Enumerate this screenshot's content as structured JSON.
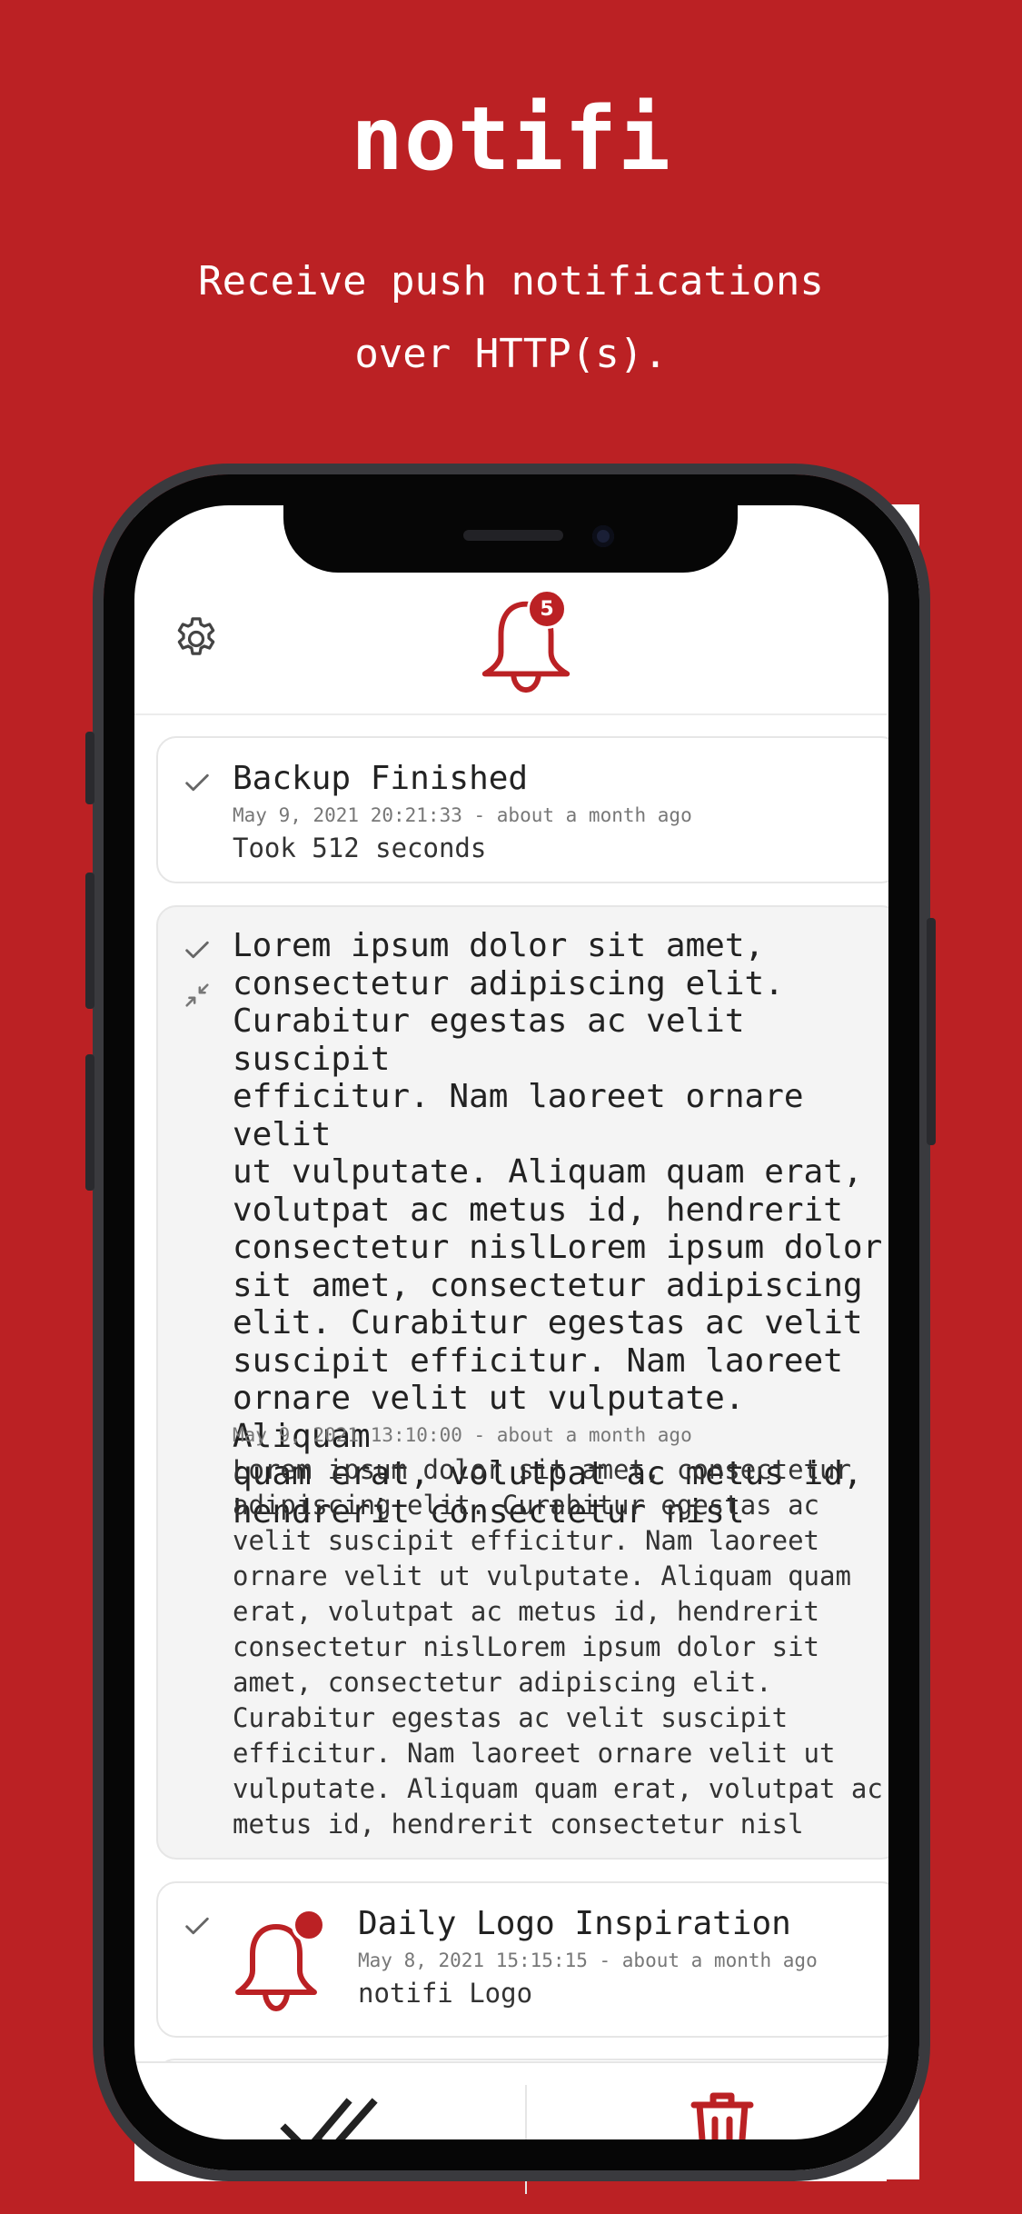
{
  "hero": {
    "title": "notifi",
    "subtitle_line1": "Receive push notifications",
    "subtitle_line2": "over HTTP(s)."
  },
  "header": {
    "settings_icon": "gear-icon",
    "bell_icon": "bell-icon",
    "badge_count": "5"
  },
  "notifications": [
    {
      "title": "Backup Finished",
      "time": "May 9, 2021 20:21:33 - about a month ago",
      "message": "Took 512 seconds"
    },
    {
      "title_lines": [
        "Lorem ipsum dolor sit amet,",
        "consectetur adipiscing elit.",
        "Curabitur egestas ac velit suscipit",
        "efficitur. Nam laoreet ornare velit",
        "ut vulputate. Aliquam quam erat,",
        "volutpat ac metus id, hendrerit",
        "consectetur nislLorem ipsum dolor",
        "sit amet, consectetur adipiscing",
        "elit. Curabitur egestas ac velit",
        "suscipit efficitur. Nam laoreet",
        "ornare velit ut vulputate. Aliquam",
        "quam erat, volutpat ac metus id,",
        "hendrerit consectetur nisl"
      ],
      "time": "May 9, 2021 13:10:00 - about a month ago",
      "message_lines": [
        "Lorem ipsum dolor sit amet, consectetur",
        "adipiscing elit. Curabitur egestas ac",
        "velit suscipit efficitur. Nam laoreet",
        "ornare velit ut vulputate. Aliquam quam",
        "erat, volutpat ac metus id, hendrerit",
        "consectetur nislLorem ipsum dolor sit",
        "amet, consectetur adipiscing elit.",
        "Curabitur egestas ac velit suscipit",
        "efficitur. Nam laoreet ornare velit ut",
        "vulputate. Aliquam quam erat, volutpat ac",
        "metus id, hendrerit consectetur nisl"
      ]
    },
    {
      "title": "Daily Logo Inspiration",
      "time": "May 8, 2021 15:15:15 - about a month ago",
      "message": "notifi Logo"
    }
  ],
  "bottom_bar": {
    "mark_all_icon": "double-check-icon",
    "delete_icon": "trash-icon"
  },
  "colors": {
    "brand": "#bb2124",
    "card_border": "#e6e6e6",
    "expanded_bg": "#f4f4f4"
  }
}
